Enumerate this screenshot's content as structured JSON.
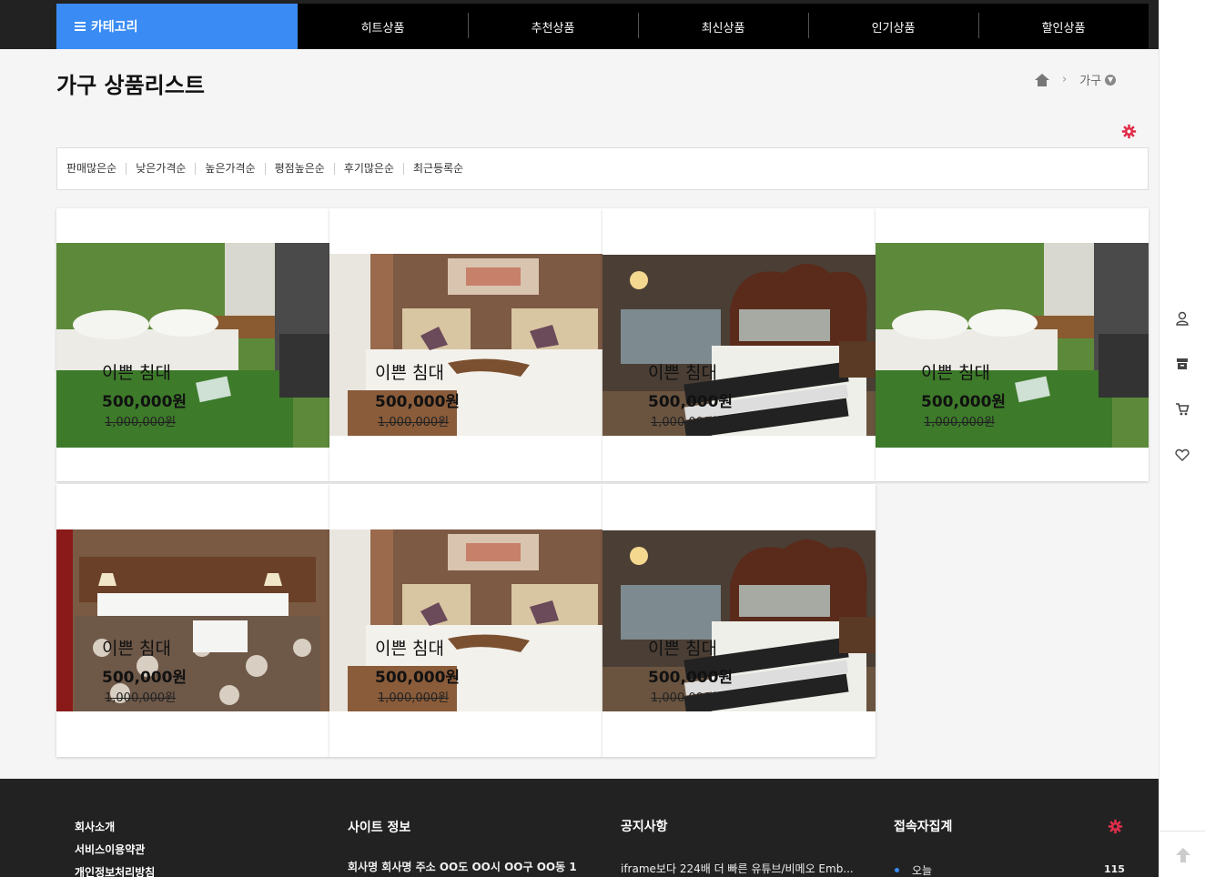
{
  "nav": {
    "category_label": "카테고리",
    "items": [
      {
        "label": "히트상품"
      },
      {
        "label": "추천상품"
      },
      {
        "label": "최신상품"
      },
      {
        "label": "인기상품"
      },
      {
        "label": "할인상품"
      }
    ]
  },
  "page": {
    "title": "가구 상품리스트",
    "breadcrumb_current": "가구"
  },
  "sort": {
    "options": [
      "판매많은순",
      "낮은가격순",
      "높은가격순",
      "평점높은순",
      "후기많은순",
      "최근등록순"
    ]
  },
  "products": [
    {
      "name": "이쁜 침대",
      "price": "500,000원",
      "original_price": "1,000,000원",
      "image": "green-room-bed"
    },
    {
      "name": "이쁜 침대",
      "price": "500,000원",
      "original_price": "1,000,000원",
      "image": "twin-bed-hotel"
    },
    {
      "name": "이쁜 침대",
      "price": "500,000원",
      "original_price": "1,000,000원",
      "image": "classic-bedroom"
    },
    {
      "name": "이쁜 침대",
      "price": "500,000원",
      "original_price": "1,000,000원",
      "image": "green-room-bed"
    },
    {
      "name": "이쁜 침대",
      "price": "500,000원",
      "original_price": "1,000,000원",
      "image": "patterned-bed"
    },
    {
      "name": "이쁜 침대",
      "price": "500,000원",
      "original_price": "1,000,000원",
      "image": "twin-bed-hotel"
    },
    {
      "name": "이쁜 침대",
      "price": "500,000원",
      "original_price": "1,000,000원",
      "image": "classic-bedroom"
    }
  ],
  "footer": {
    "links": [
      "회사소개",
      "서비스이용약관",
      "개인정보처리방침"
    ],
    "site_info_title": "사이트 정보",
    "site_info_text": "회사명 회사명 주소 OO도 OO시 OO구 OO동 1",
    "notice_title": "공지사항",
    "notice_item": "iframe보다 224배 더 빠른 유튜브/비메오 Emb...",
    "visitors_title": "접속자집계",
    "visitors_today_label": "오늘",
    "visitors_today_count": "115"
  },
  "rail": {
    "icons": [
      "user-icon",
      "archive-icon",
      "cart-icon",
      "heart-icon",
      "arrow-up-icon"
    ]
  },
  "colors": {
    "accent": "#3a8cf4",
    "gear": "#e02e4a",
    "nav_bg": "#000000",
    "footer_bg": "#222222"
  }
}
